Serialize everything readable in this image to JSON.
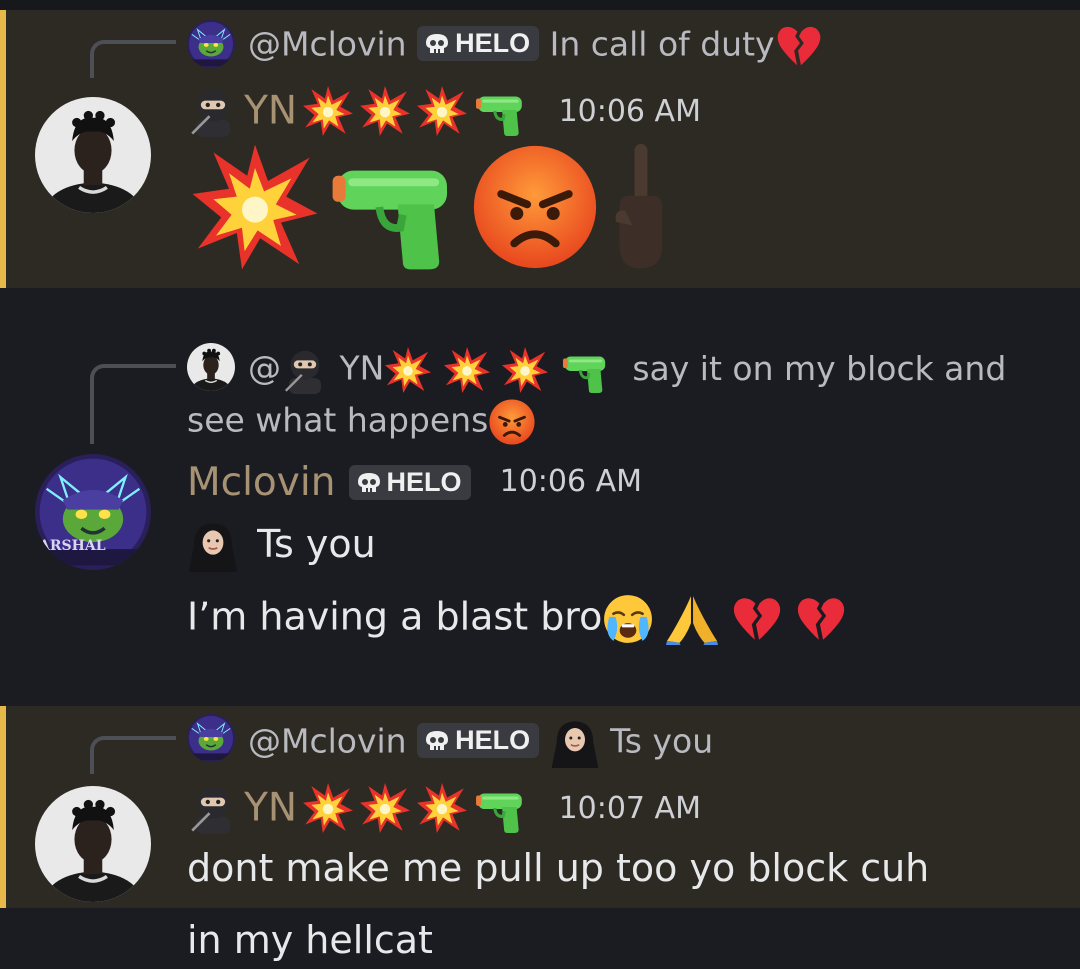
{
  "messages": [
    {
      "reply": {
        "mention": "@Mclovin",
        "tag": "HELO",
        "text": "In call of duty",
        "end_emoji": "broken-heart-icon"
      },
      "author": "YN",
      "time": "10:06 AM",
      "body": []
    },
    {
      "reply": {
        "mention": "@",
        "name": "YN",
        "text_1": "say it on my block and",
        "text_2": "see what happens"
      },
      "author": "Mclovin",
      "tag": "HELO",
      "time": "10:06 AM",
      "avatar_text": "ARSHAL",
      "body": [
        "Ts you",
        "I’m having a blast bro"
      ]
    },
    {
      "reply": {
        "mention": "@Mclovin",
        "tag": "HELO",
        "text": "Ts you"
      },
      "author": "YN",
      "time": "10:07 AM",
      "body": [
        "dont make me pull up too yo block cuh",
        "in my hellcat"
      ]
    }
  ],
  "colors": {
    "background": "#1b1c21",
    "highlight": "#2d2a24",
    "highlight_bar": "#e6b94a",
    "author_color": "#a89274"
  }
}
